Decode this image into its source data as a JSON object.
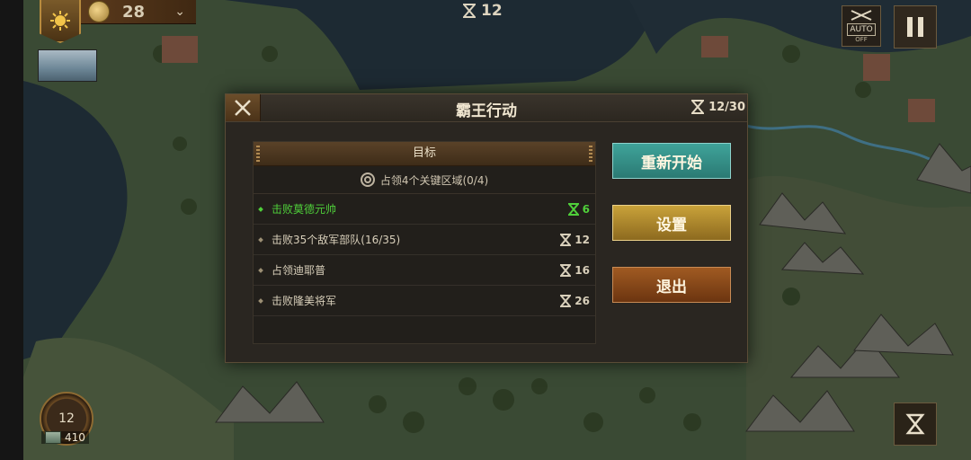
{
  "hud": {
    "coins": "28",
    "turn_top": "12",
    "auto_label": "AUTO",
    "auto_state": "OFF",
    "medal_turn": "12",
    "resources": "410"
  },
  "dialog": {
    "title": "霸王行动",
    "turns": "12/30",
    "objectives_header": "目标",
    "main_objective": "占领4个关键区域(0/4)",
    "sub_objectives": [
      {
        "text": "击败莫德元帅",
        "turns": "6",
        "done": true
      },
      {
        "text": "击败35个敌军部队(16/35)",
        "turns": "12",
        "done": false
      },
      {
        "text": "占领迪耶普",
        "turns": "16",
        "done": false
      },
      {
        "text": "击败隆美将军",
        "turns": "26",
        "done": false
      }
    ],
    "buttons": {
      "restart": "重新开始",
      "settings": "设置",
      "exit": "退出"
    }
  },
  "colors": {
    "restart": "#3fa39a",
    "settings": "#c9a23a",
    "exit": "#a05a22",
    "completed": "#4fcf3a"
  },
  "icons": [
    "sun-emblem-icon",
    "coin-icon",
    "chevron-down-icon",
    "hourglass-icon",
    "auto-soldiers-icon",
    "pause-icon",
    "close-icon",
    "target-icon",
    "flag-icon",
    "resource-icon",
    "medal-icon"
  ]
}
